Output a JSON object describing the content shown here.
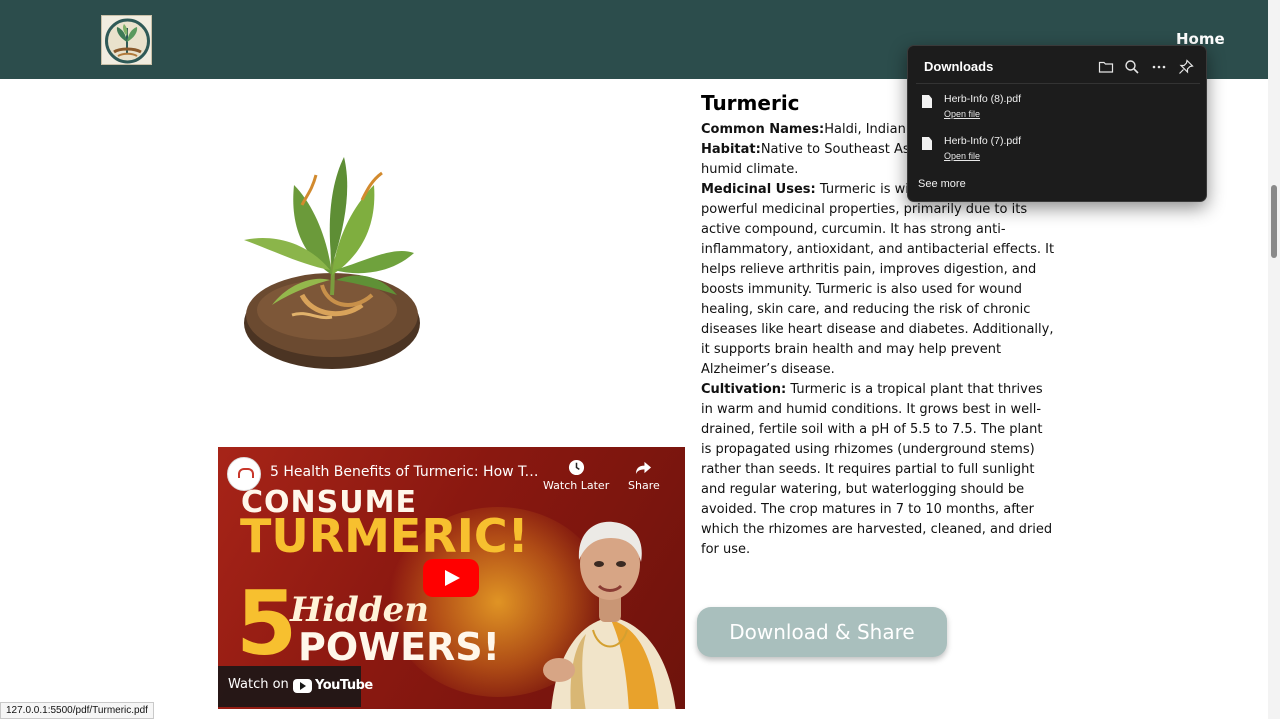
{
  "nav": {
    "home_label": "Home"
  },
  "herb": {
    "title": "Turmeric",
    "common_names_label": "Common Names:",
    "common_names_value": "Haldi, Indian",
    "habitat_label": "Habitat:",
    "habitat_value": "Native to Southeast As",
    "habitat_value_cont": "humid climate.",
    "medicinal_label": "Medicinal Uses:",
    "medicinal_value_start": " Turmeric is wid",
    "medicinal_value_rest": "powerful medicinal properties, primarily due to its active compound, curcumin. It has strong anti-inflammatory, antioxidant, and antibacterial effects. It helps relieve arthritis pain, improves digestion, and boosts immunity. Turmeric is also used for wound healing, skin care, and reducing the risk of chronic diseases like heart disease and diabetes. Additionally, it supports brain health and may help prevent Alzheimer’s disease.",
    "cultivation_label": "Cultivation:",
    "cultivation_value": " Turmeric is a tropical plant that thrives in warm and humid conditions. It grows best in well-drained, fertile soil with a pH of 5.5 to 7.5. The plant is propagated using rhizomes (underground stems) rather than seeds. It requires partial to full sunlight and regular watering, but waterlogging should be avoided. The crop matures in 7 to 10 months, after which the rhizomes are harvested, cleaned, and dried for use."
  },
  "video": {
    "title": "5 Health Benefits of Turmeric: How Tur...",
    "watch_later": "Watch Later",
    "share": "Share",
    "thumb_line1": "CONSUME",
    "thumb_line2": "TURMERIC!",
    "thumb_number": "5",
    "thumb_line3": "Hidden",
    "thumb_line4": "POWERS!",
    "watch_on": "Watch on",
    "youtube": "YouTube"
  },
  "download_button": "Download & Share",
  "downloads_panel": {
    "title": "Downloads",
    "items": [
      {
        "name": "Herb-Info (8).pdf",
        "action": "Open file"
      },
      {
        "name": "Herb-Info (7).pdf",
        "action": "Open file"
      }
    ],
    "see_more": "See more"
  },
  "status_bar": {
    "url": "127.0.0.1:5500/pdf/Turmeric.pdf"
  },
  "colors": {
    "header_bg": "#2c4d4c",
    "download_button_bg": "#a9bfbd",
    "panel_bg": "#1c1c1c",
    "video_accent": "#f7c02f"
  },
  "icons": [
    "logo-icon",
    "folder-icon",
    "search-icon",
    "more-icon",
    "pin-icon",
    "file-icon",
    "clock-icon",
    "share-icon",
    "play-icon",
    "youtube-icon"
  ]
}
